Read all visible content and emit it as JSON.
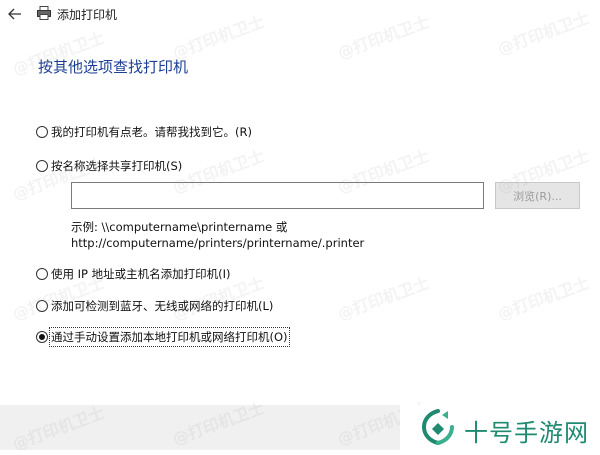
{
  "window": {
    "title": "添加打印机"
  },
  "page": {
    "heading": "按其他选项查找打印机"
  },
  "options": [
    {
      "label": "我的打印机有点老。请帮我找到它。(R)",
      "checked": false
    },
    {
      "label": "按名称选择共享打印机(S)",
      "checked": false
    },
    {
      "label": "使用 IP 地址或主机名添加打印机(I)",
      "checked": false
    },
    {
      "label": "添加可检测到蓝牙、无线或网络的打印机(L)",
      "checked": false
    },
    {
      "label": "通过手动设置添加本地打印机或网络打印机(O)",
      "checked": true
    }
  ],
  "shared_printer": {
    "input_value": "",
    "browse_label": "浏览(R)...",
    "example_line1": "示例: \\\\computername\\printername 或",
    "example_line2": "http://computername/printers/printername/.printer"
  },
  "watermark": {
    "text": "@打印机卫士"
  },
  "brand": {
    "text": "十号手游网",
    "color": "#1f8a70"
  },
  "icons": [
    "back-arrow-icon",
    "printer-icon",
    "brand-logo-icon"
  ]
}
